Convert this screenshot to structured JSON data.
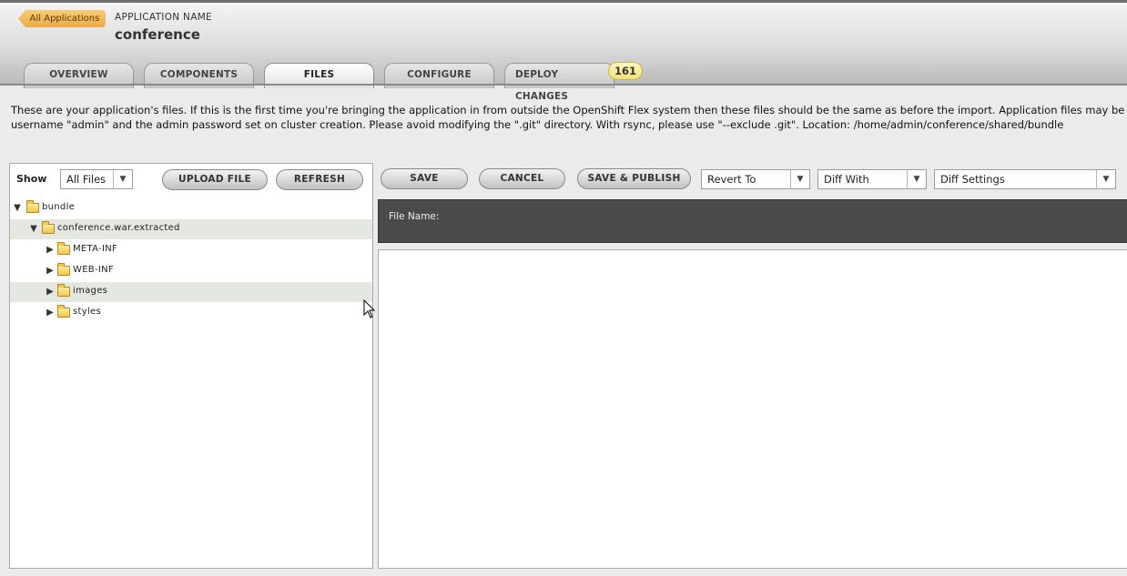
{
  "header": {
    "back_label": "All Applications",
    "app_name_label": "APPLICATION NAME",
    "app_name": "conference",
    "tabs": [
      {
        "label": "OVERVIEW"
      },
      {
        "label": "COMPONENTS"
      },
      {
        "label": "FILES"
      },
      {
        "label": "CONFIGURE"
      },
      {
        "label": "DEPLOY CHANGES"
      }
    ],
    "deploy_badge": "161"
  },
  "description": {
    "line1": "These are your application's files.  If this is the first time you're bringing the application in from outside the OpenShift Flex system then these files should be the same as before the import. Application files may be edited in an ssh",
    "line2": "username \"admin\" and the admin password set on cluster creation. Please avoid modifying the \".git\" directory. With rsync, please use \"--exclude .git\". Location: /home/admin/conference/shared/bundle"
  },
  "file_panel": {
    "show_label": "Show",
    "show_value": "All Files",
    "upload_label": "UPLOAD FILE",
    "refresh_label": "REFRESH",
    "tree": [
      {
        "label": "bundle"
      },
      {
        "label": "conference.war.extracted"
      },
      {
        "label": "META-INF"
      },
      {
        "label": "WEB-INF"
      },
      {
        "label": "images"
      },
      {
        "label": "styles"
      }
    ]
  },
  "editor_panel": {
    "save_label": "SAVE",
    "cancel_label": "CANCEL",
    "save_publish_label": "SAVE & PUBLISH",
    "revert_to": "Revert To",
    "diff_with": "Diff With",
    "diff_settings": "Diff Settings",
    "file_name_label": "File Name:"
  },
  "colors": {
    "accent_orange": "#eeaa45",
    "badge_yellow": "#f1e07a",
    "file_header_bg": "#4a4a4a"
  }
}
